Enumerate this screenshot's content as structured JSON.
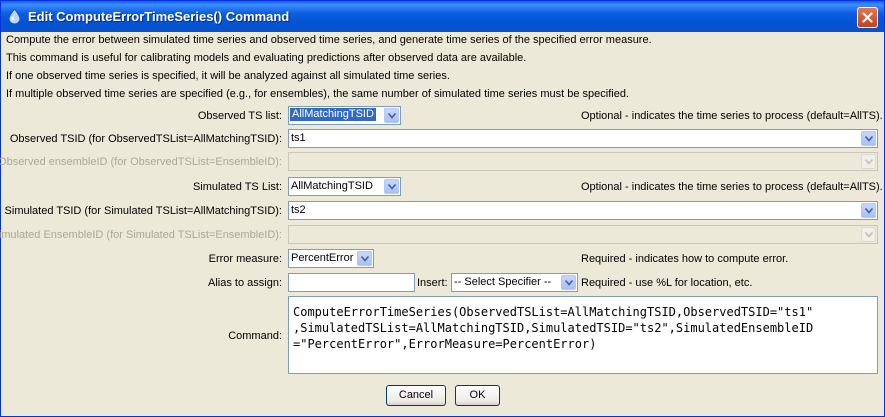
{
  "window": {
    "title": "Edit ComputeErrorTimeSeries() Command"
  },
  "info_lines": [
    "Compute the error between simulated time series and observed time series, and generate time series of the specified error measure.",
    "This command is useful for calibrating models and evaluating predictions after observed data are available.",
    "If one observed time series is specified, it will be analyzed against all simulated time series.",
    "If multiple observed time series are specified (e.g., for ensembles), the same number of simulated time series must be specified."
  ],
  "form": {
    "observed_ts_list": {
      "label": "Observed TS list:",
      "value": "AllMatchingTSID",
      "hint": "Optional - indicates the time series to process (default=AllTS)."
    },
    "observed_tsid": {
      "label": "Observed TSID (for ObservedTSList=AllMatchingTSID):",
      "value": "ts1"
    },
    "observed_ensemble": {
      "label": "Observed ensembleID (for ObservedTSList=EnsembleID):",
      "value": ""
    },
    "simulated_ts_list": {
      "label": "Simulated TS List:",
      "value": "AllMatchingTSID",
      "hint": "Optional - indicates the time series to process (default=AllTS)."
    },
    "simulated_tsid": {
      "label": "Simulated TSID (for Simulated TSList=AllMatchingTSID):",
      "value": "ts2"
    },
    "simulated_ensemble": {
      "label": "Simulated EnsembleID (for Simulated TSList=EnsembleID):",
      "value": ""
    },
    "error_measure": {
      "label": "Error measure:",
      "value": "PercentError",
      "hint": "Required - indicates how to compute error."
    },
    "alias": {
      "label": "Alias to assign:",
      "value": "",
      "insert_label": "Insert:",
      "specifier": "-- Select Specifier --",
      "hint": "Required - use %L for location, etc."
    },
    "command": {
      "label": "Command:",
      "lines": [
        "ComputeErrorTimeSeries(ObservedTSList=AllMatchingTSID,ObservedTSID=\"ts1\"",
        ",SimulatedTSList=AllMatchingTSID,SimulatedTSID=\"ts2\",SimulatedEnsembleID",
        "=\"PercentError\",ErrorMeasure=PercentError)"
      ]
    }
  },
  "buttons": {
    "cancel": "Cancel",
    "ok": "OK"
  }
}
